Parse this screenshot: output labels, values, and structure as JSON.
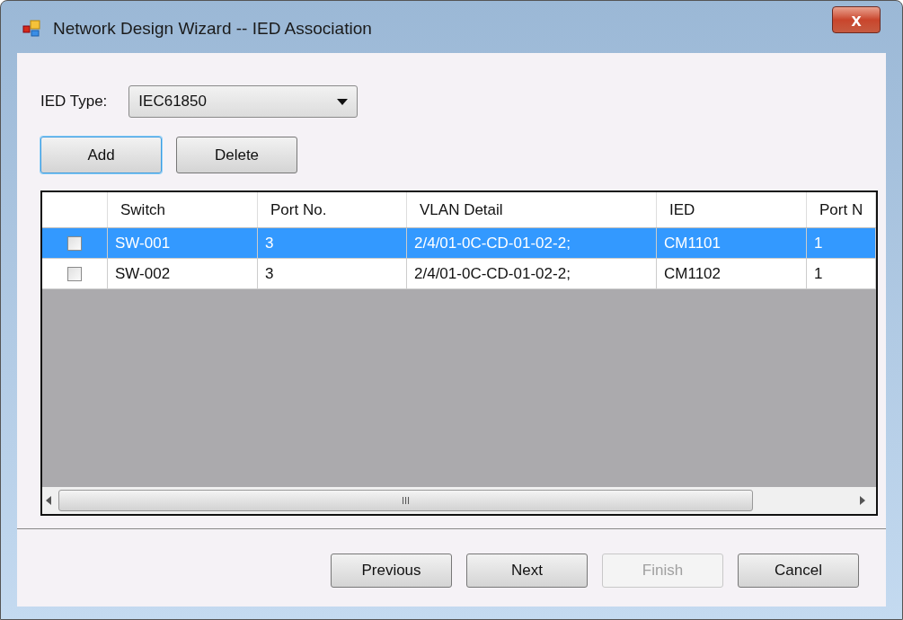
{
  "window": {
    "title": "Network Design Wizard -- IED Association",
    "close_label": "x"
  },
  "ied_type": {
    "label": "IED Type:",
    "value": "IEC61850"
  },
  "actions": [
    {
      "label": "Add",
      "focused": true
    },
    {
      "label": "Delete",
      "focused": false
    }
  ],
  "table": {
    "columns": [
      "Switch",
      "Port No.",
      "VLAN Detail",
      "IED",
      "Port N"
    ],
    "rows": [
      {
        "checked": false,
        "selected": true,
        "cells": [
          "SW-001",
          "3",
          "2/4/01-0C-CD-01-02-2;",
          "CM1101",
          "1"
        ]
      },
      {
        "checked": false,
        "selected": false,
        "cells": [
          "SW-002",
          "3",
          "2/4/01-0C-CD-01-02-2;",
          "CM1102",
          "1"
        ]
      }
    ],
    "scroll_grip": "III"
  },
  "buttons": [
    {
      "label": "Previous",
      "disabled": false
    },
    {
      "label": "Next",
      "disabled": false
    },
    {
      "label": "Finish",
      "disabled": true
    },
    {
      "label": "Cancel",
      "disabled": false
    }
  ]
}
